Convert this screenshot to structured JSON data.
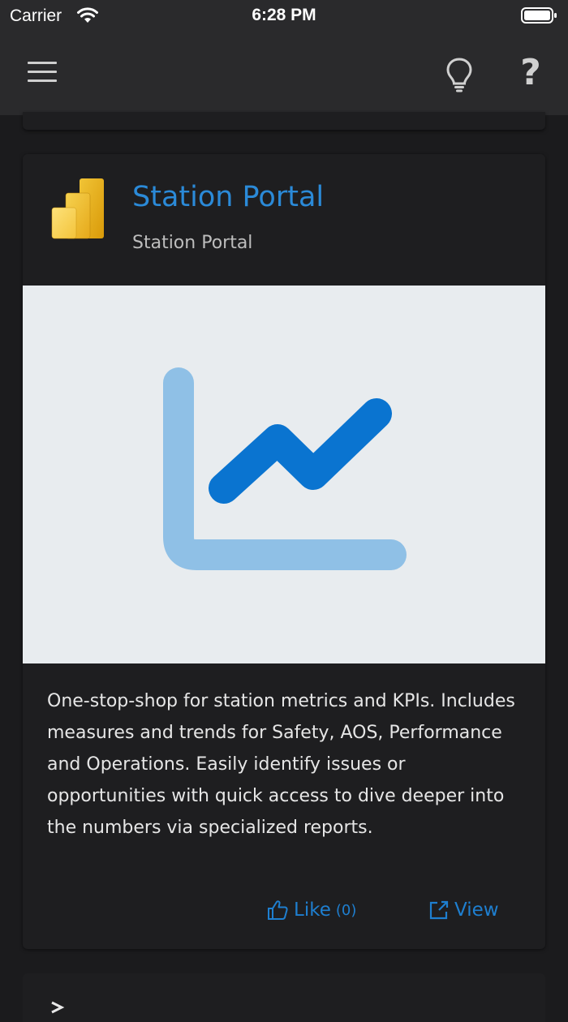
{
  "status_bar": {
    "carrier": "Carrier",
    "time": "6:28 PM"
  },
  "navbar": {
    "menu_icon": "hamburger-icon",
    "tips_icon": "lightbulb-icon",
    "help_icon": "question-icon",
    "help_label": "?"
  },
  "card": {
    "title": "Station Portal",
    "subtitle": "Station Portal",
    "logo_icon": "power-bi-icon",
    "thumbnail_icon": "line-chart-icon",
    "description": "One-stop-shop for station metrics and KPIs. Includes measures and trends for Safety, AOS, Performance and Operations. Easily identify issues or opportunities with quick access to dive deeper into the numbers via specialized reports.",
    "like_label": "Like",
    "like_count": "(0)",
    "view_label": "View"
  },
  "colors": {
    "accent": "#1e7fd0",
    "title_link": "#2b8ad8",
    "background": "#1b1b1d",
    "card": "#1e1e20",
    "thumbnail_bg": "#e8ecef",
    "chart_axis": "#8fc0e6",
    "chart_line": "#0a74d0"
  }
}
